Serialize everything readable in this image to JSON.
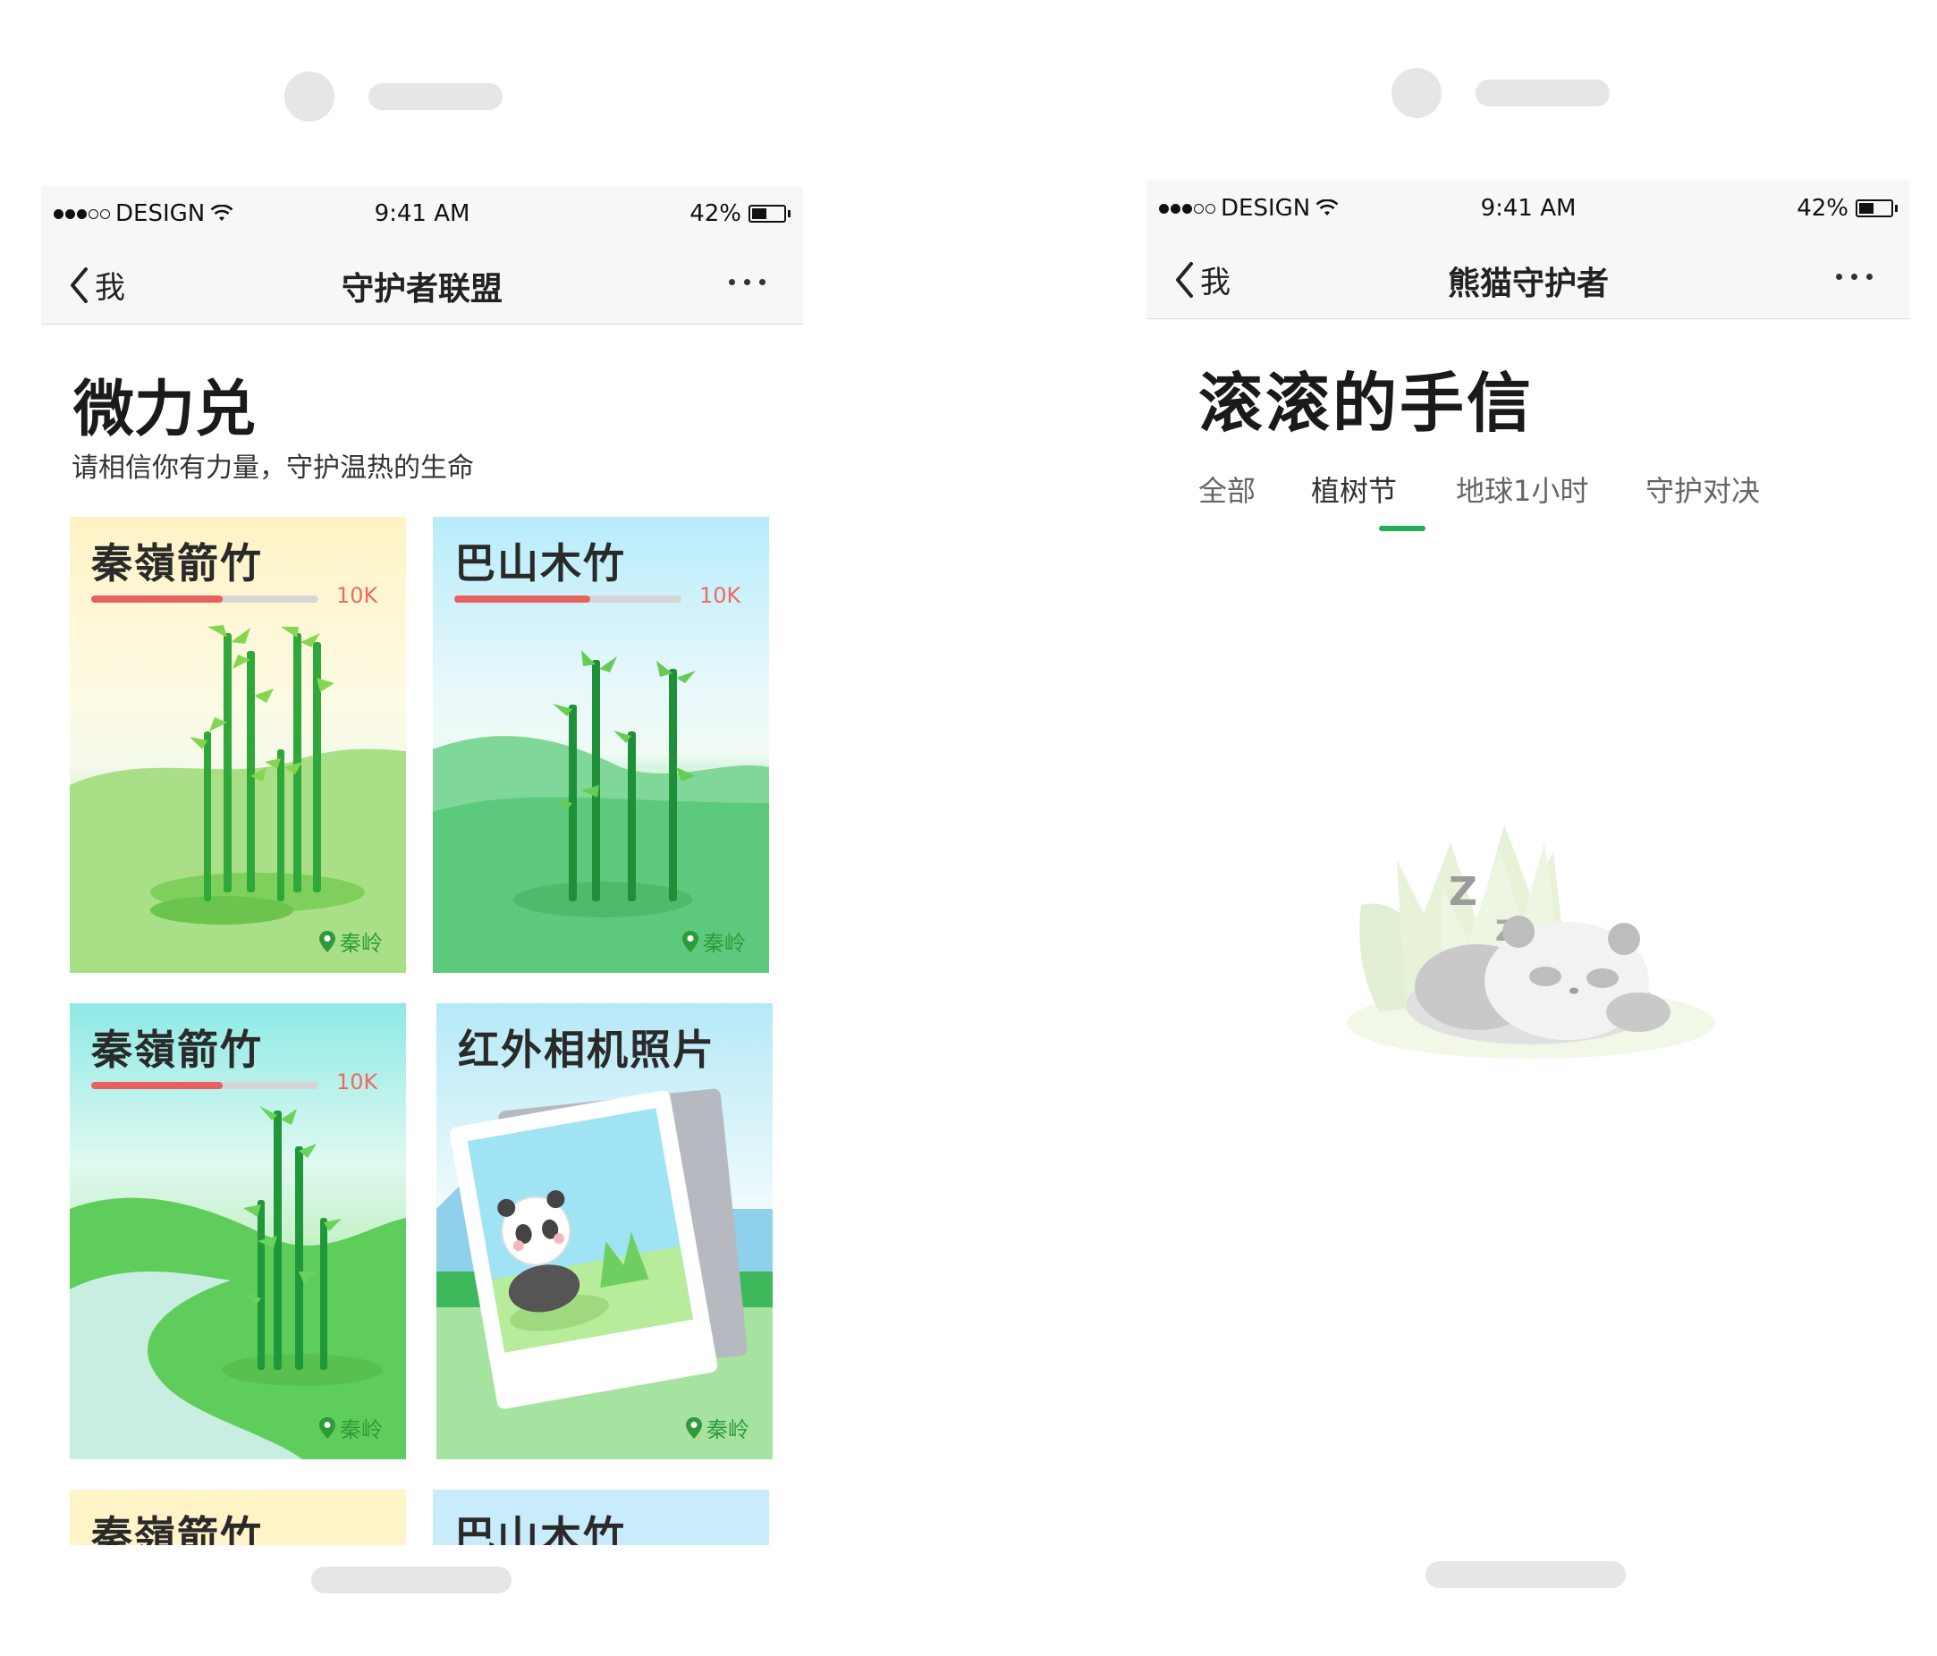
{
  "colors": {
    "accent_green": "#1fb054",
    "progress_red": "#e8615c",
    "location_green": "#2f9a3c",
    "bar_bg": "#f7f7f7"
  },
  "left_phone": {
    "status": {
      "carrier": "DESIGN",
      "time": "9:41 AM",
      "battery": "42%"
    },
    "nav": {
      "back_label": "我",
      "title": "守护者联盟",
      "more_icon": "more-icon"
    },
    "page_title": "微力兑",
    "subtitle": "请相信你有力量，守护温热的生命",
    "cards": [
      {
        "title": "秦嶺箭竹",
        "count": "10K",
        "progress": 0.58,
        "location": "秦岭"
      },
      {
        "title": "巴山木竹",
        "count": "10K",
        "progress": 0.6,
        "location": "秦岭"
      },
      {
        "title": "秦嶺箭竹",
        "count": "10K",
        "progress": 0.58,
        "location": "秦岭"
      },
      {
        "title": "红外相机照片",
        "location": "秦岭"
      },
      {
        "title": "秦嶺箭竹"
      },
      {
        "title": "巴山木竹"
      }
    ]
  },
  "right_phone": {
    "status": {
      "carrier": "DESIGN",
      "time": "9:41 AM",
      "battery": "42%"
    },
    "nav": {
      "back_label": "我",
      "title": "熊猫守护者",
      "more_icon": "more-icon"
    },
    "page_title": "滚滚的手信",
    "tabs": [
      {
        "label": "全部",
        "active": false
      },
      {
        "label": "植树节",
        "active": true
      },
      {
        "label": "地球1小时",
        "active": false
      },
      {
        "label": "守护对决",
        "active": false
      }
    ],
    "empty_state": {
      "illustration": "sleeping-panda"
    }
  }
}
